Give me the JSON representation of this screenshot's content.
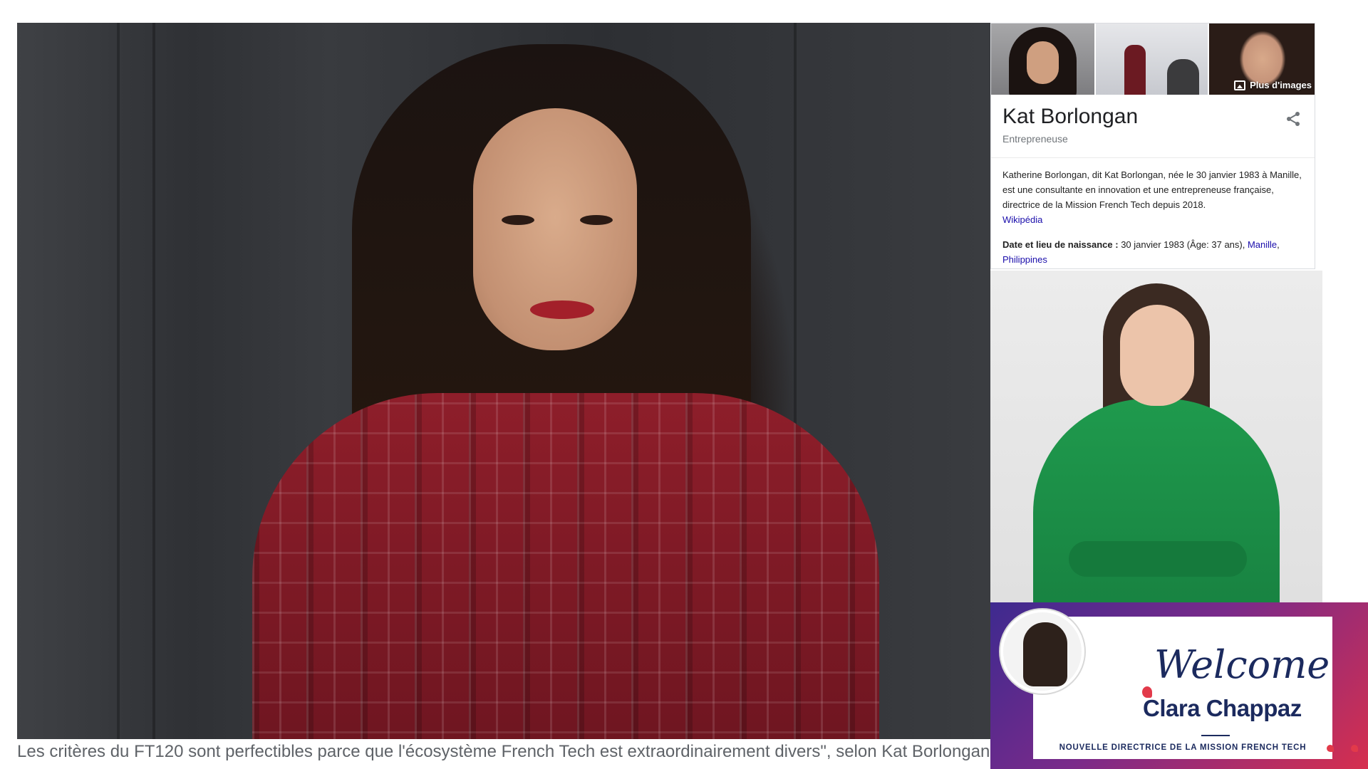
{
  "main_image": {
    "caption": "Les critères du FT120 sont perfectibles parce que l'écosystème French Tech est extraordinairement divers\", selon Kat Borlongan"
  },
  "knowledge_panel": {
    "more_images_label": "Plus d'images",
    "title": "Kat Borlongan",
    "subtitle": "Entrepreneuse",
    "description": "Katherine Borlongan, dit Kat Borlongan, née le 30 janvier 1983 à Manille, est une consultante en innovation et une entrepreneuse française, directrice de la Mission French Tech depuis 2018.",
    "source_link": "Wikipédia",
    "fact_label": "Date et lieu de naissance :",
    "fact_value": " 30 janvier 1983 (Âge: 37 ans), ",
    "fact_link_city": "Manille",
    "fact_separator": ", ",
    "fact_link_country": "Philippines",
    "share_icon": "share-icon"
  },
  "welcome_card": {
    "title": "Welcome",
    "name": "Clara Chappaz",
    "subtitle": "NOUVELLE DIRECTRICE DE LA MISSION FRENCH TECH"
  },
  "colors": {
    "link": "#1a0dab",
    "navy": "#1b2a5e",
    "gradient_start": "#3e2a8f",
    "gradient_end": "#d62f4e",
    "sweater": "#1f9a4d"
  }
}
